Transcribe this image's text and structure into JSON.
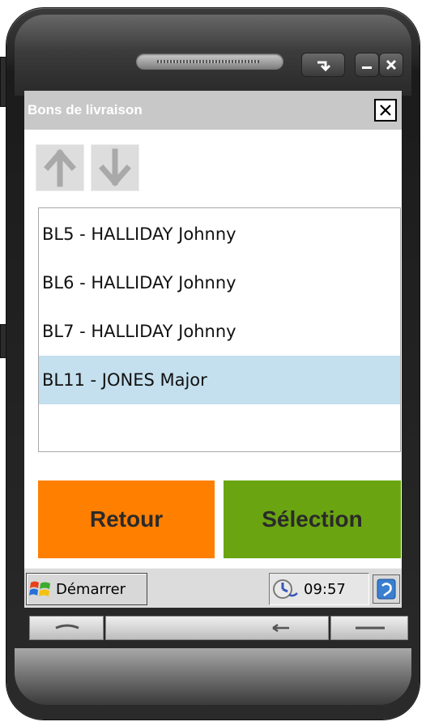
{
  "window": {
    "title": "Bons de livraison",
    "close_label": "✕"
  },
  "nav": {
    "up_icon": "arrow-up-icon",
    "down_icon": "arrow-down-icon"
  },
  "list": {
    "items": [
      {
        "label": "BL5 - HALLIDAY Johnny",
        "selected": false
      },
      {
        "label": "BL6 - HALLIDAY Johnny",
        "selected": false
      },
      {
        "label": "BL7 - HALLIDAY Johnny",
        "selected": false
      },
      {
        "label": "BL11 - JONES Major",
        "selected": true
      }
    ]
  },
  "actions": {
    "back_label": "Retour",
    "select_label": "Sélection"
  },
  "taskbar": {
    "start_label": "Démarrer",
    "time": "09:57"
  },
  "colors": {
    "back_button": "#ff7f00",
    "select_button": "#6aa511",
    "selected_row": "#c4dfee",
    "titlebar": "#c8c8c8"
  }
}
